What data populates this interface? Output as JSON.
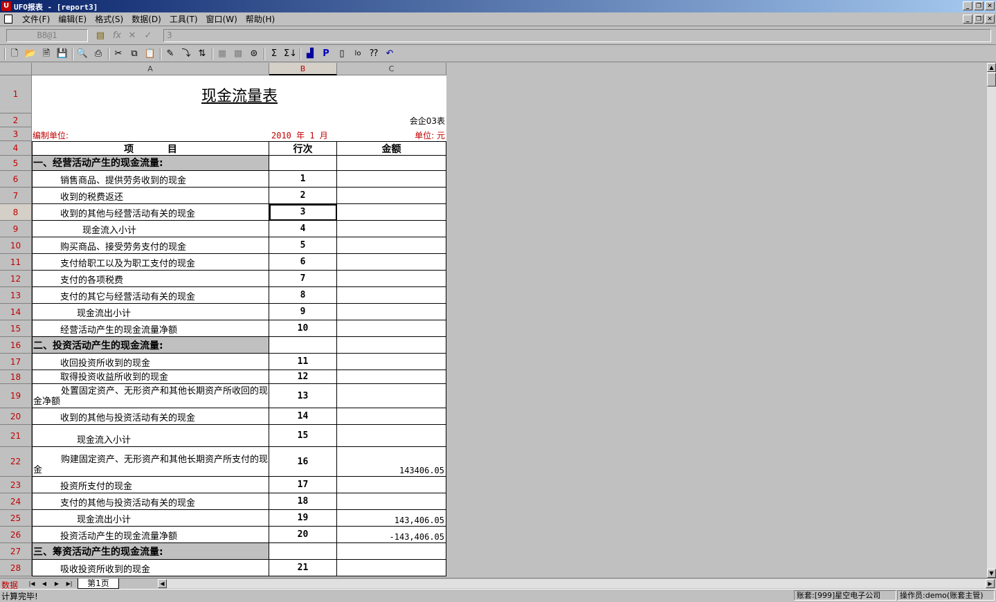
{
  "window": {
    "title": "UFO报表 - [report3]"
  },
  "menu": [
    "文件(F)",
    "编辑(E)",
    "格式(S)",
    "数据(D)",
    "工具(T)",
    "窗口(W)",
    "帮助(H)"
  ],
  "formula_bar": {
    "cell_ref": "B8@1",
    "value": "3"
  },
  "columns": [
    "A",
    "B",
    "C"
  ],
  "report": {
    "title": "现金流量表",
    "code": "会企03表",
    "unit_label": "编制单位:",
    "period": "2010 年  1 月",
    "currency": "单位: 元",
    "headers": {
      "item": "项          目",
      "line": "行次",
      "amount": "金额"
    }
  },
  "rows": [
    {
      "row": "5",
      "item": "一、经营活动产生的现金流量:",
      "line": "",
      "amount": "",
      "kind": "sec"
    },
    {
      "row": "6",
      "item": "销售商品、提供劳务收到的现金",
      "line": "1",
      "amount": "",
      "kind": "lbl"
    },
    {
      "row": "7",
      "item": "收到的税费返还",
      "line": "2",
      "amount": "",
      "kind": "lbl"
    },
    {
      "row": "8",
      "item": "收到的其他与经营活动有关的现金",
      "line": "3",
      "amount": "",
      "kind": "lbl"
    },
    {
      "row": "9",
      "item": "现金流入小计",
      "line": "4",
      "amount": "",
      "kind": "lbl3"
    },
    {
      "row": "10",
      "item": "购买商品、接受劳务支付的现金",
      "line": "5",
      "amount": "",
      "kind": "lbl"
    },
    {
      "row": "11",
      "item": "支付给职工以及为职工支付的现金",
      "line": "6",
      "amount": "",
      "kind": "lbl"
    },
    {
      "row": "12",
      "item": "支付的各项税费",
      "line": "7",
      "amount": "",
      "kind": "lbl"
    },
    {
      "row": "13",
      "item": "支付的其它与经营活动有关的现金",
      "line": "8",
      "amount": "",
      "kind": "lbl"
    },
    {
      "row": "14",
      "item": "现金流出小计",
      "line": "9",
      "amount": "",
      "kind": "lbl2"
    },
    {
      "row": "15",
      "item": "经营活动产生的现金流量净额",
      "line": "10",
      "amount": "",
      "kind": "lbl"
    },
    {
      "row": "16",
      "item": "二、投资活动产生的现金流量:",
      "line": "",
      "amount": "",
      "kind": "sec"
    },
    {
      "row": "17",
      "item": "收回投资所收到的现金",
      "line": "11",
      "amount": "",
      "kind": "lbl"
    },
    {
      "row": "18",
      "item": "取得投资收益所收到的现金",
      "line": "12",
      "amount": "",
      "kind": "lbl"
    },
    {
      "row": "19",
      "item": "处置固定资产、无形资产和其他长期资产所收回的现金净额",
      "line": "13",
      "amount": "",
      "kind": "wrap"
    },
    {
      "row": "20",
      "item": "收到的其他与投资活动有关的现金",
      "line": "14",
      "amount": "",
      "kind": "lbl"
    },
    {
      "row": "21",
      "item": "现金流入小计",
      "line": "15",
      "amount": "",
      "kind": "lbl2"
    },
    {
      "row": "22",
      "item": "购建固定资产、无形资产和其他长期资产所支付的现金",
      "line": "16",
      "amount": "143406.05",
      "kind": "wrap"
    },
    {
      "row": "23",
      "item": "投资所支付的现金",
      "line": "17",
      "amount": "",
      "kind": "lbl"
    },
    {
      "row": "24",
      "item": "支付的其他与投资活动有关的现金",
      "line": "18",
      "amount": "",
      "kind": "lbl"
    },
    {
      "row": "25",
      "item": "现金流出小计",
      "line": "19",
      "amount": "143,406.05",
      "kind": "lbl2"
    },
    {
      "row": "26",
      "item": "投资活动产生的现金流量净额",
      "line": "20",
      "amount": "-143,406.05",
      "kind": "lbl"
    },
    {
      "row": "27",
      "item": "三、筹资活动产生的现金流量:",
      "line": "",
      "amount": "",
      "kind": "sec"
    },
    {
      "row": "28",
      "item": "吸收投资所收到的现金",
      "line": "21",
      "amount": "",
      "kind": "lbl"
    }
  ],
  "tabs": {
    "mode": "数据",
    "sheet": "第1页"
  },
  "status": {
    "message": "计算完毕!",
    "account": "账套:[999]星空电子公司",
    "operator": "操作员:demo(账套主管)"
  }
}
